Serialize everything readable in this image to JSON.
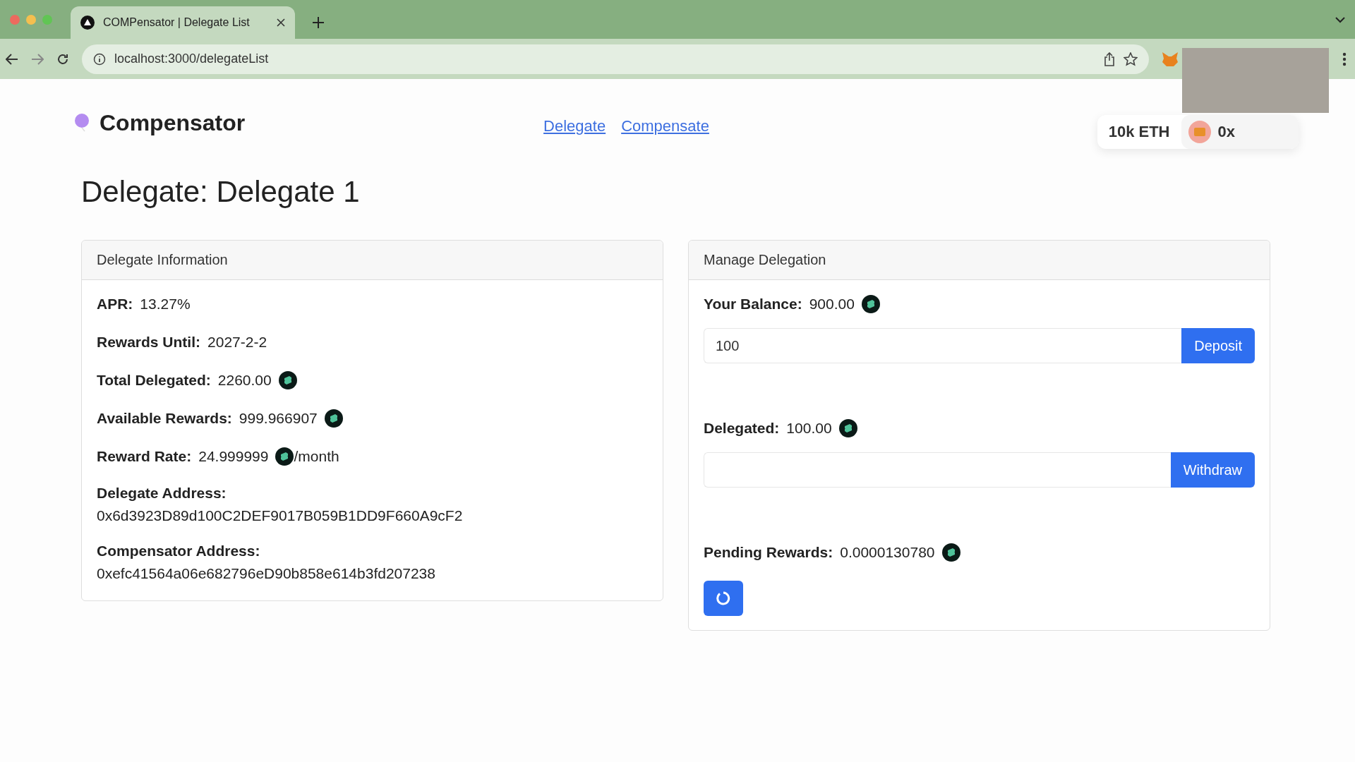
{
  "browser": {
    "tab_title": "COMPensator | Delegate List",
    "url": "localhost:3000/delegateList"
  },
  "header": {
    "brand": "Compensator",
    "nav": [
      {
        "label": "Delegate"
      },
      {
        "label": "Compensate"
      }
    ],
    "wallet": {
      "balance": "10k ETH",
      "address": "0x"
    }
  },
  "page_title": "Delegate: Delegate 1",
  "info_card": {
    "title": "Delegate Information",
    "rows": [
      {
        "kind": "inline",
        "label": "APR:",
        "value": "13.27%",
        "token": false
      },
      {
        "kind": "inline",
        "label": "Rewards Until:",
        "value": "2027-2-2",
        "token": false
      },
      {
        "kind": "inline",
        "label": "Total Delegated:",
        "value": "2260.00",
        "token": true
      },
      {
        "kind": "inline",
        "label": "Available Rewards:",
        "value": "999.966907",
        "token": true
      },
      {
        "kind": "inline",
        "label": "Reward Rate:",
        "value": "24.999999",
        "token": true,
        "suffix": "/month"
      },
      {
        "kind": "stacked",
        "label": "Delegate Address:",
        "value": "0x6d3923D89d100C2DEF9017B059B1DD9F660A9cF2",
        "token": false
      },
      {
        "kind": "stacked",
        "label": "Compensator Address:",
        "value": "0xefc41564a06e682796eD90b858e614b3fd207238",
        "token": false
      }
    ]
  },
  "manage_card": {
    "title": "Manage Delegation",
    "sections": [
      {
        "label": "Your Balance:",
        "value": "900.00",
        "input_value": "100",
        "button": "Deposit"
      },
      {
        "label": "Delegated:",
        "value": "100.00",
        "button": "Withdraw"
      }
    ],
    "pending": {
      "label": "Pending Rewards:",
      "value": "0.0000130780"
    }
  }
}
